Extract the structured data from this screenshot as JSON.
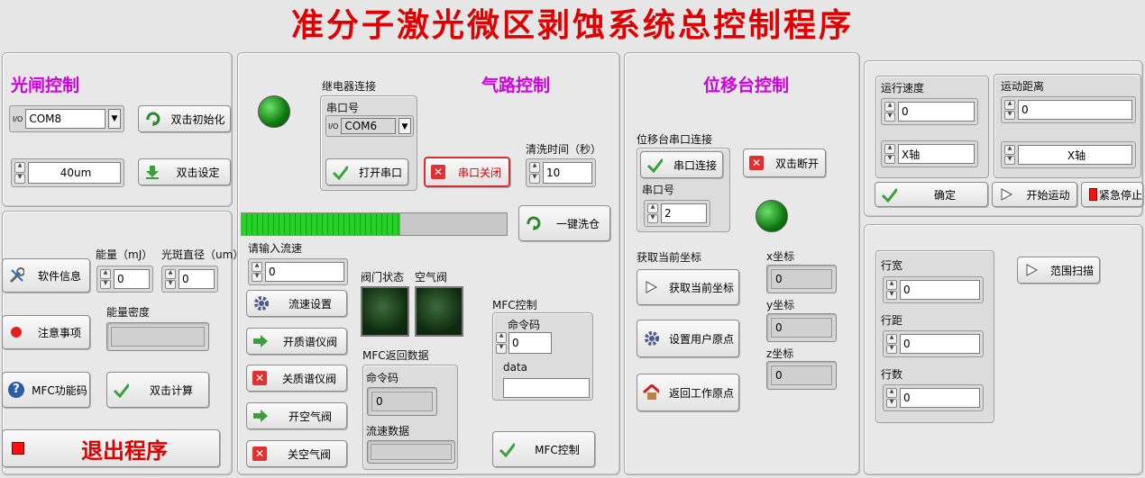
{
  "title": "准分子激光微区剥蚀系统总控制程序",
  "shutter": {
    "title": "光闸控制",
    "port_prefix": "I/O",
    "port_value": "COM8",
    "init_button": "双击初始化",
    "aperture_value": "40um",
    "set_button": "双击设定"
  },
  "left_lower": {
    "software_info": "软件信息",
    "notes": "注意事项",
    "mfc_codes": "MFC功能码",
    "energy_label": "能量（mJ）",
    "energy_value": "0",
    "spot_label": "光斑直径（um）",
    "spot_value": "0",
    "density_label": "能量密度",
    "density_value": "",
    "calc_button": "双击计算",
    "exit_button": "退出程序"
  },
  "gas": {
    "title": "气路控制",
    "relay_label": "继电器连接",
    "port_label": "串口号",
    "port_prefix": "I/O",
    "port_value": "COM6",
    "open_port": "打开串口",
    "close_port": "串口关闭",
    "purge_time_label": "清洗时间（秒）",
    "purge_time_value": "10",
    "one_key_wash": "一键洗仓",
    "progress": 0.6,
    "flow_input_label": "请输入流速",
    "flow_value": "0",
    "flow_set": "流速设置",
    "open_mass_valve": "开质谱仪阀",
    "close_mass_valve": "关质谱仪阀",
    "open_air_valve": "开空气阀",
    "close_air_valve": "关空气阀",
    "valve_state_label": "阀门状态",
    "air_valve_label": "空气阀",
    "mfc_return_label": "MFC返回数据",
    "cmd_code_label": "命令码",
    "cmd_code_value": "0",
    "flow_data_label": "流速数据",
    "flow_data_value": "",
    "mfc_ctrl_label": "MFC控制",
    "mfc_cmd_label": "命令码",
    "mfc_cmd_value": "0",
    "data_label": "data",
    "data_value": "",
    "mfc_ctrl_button": "MFC控制"
  },
  "stage": {
    "title": "位移台控制",
    "port_conn_label": "位移台串口连接",
    "port_connect": "串口连接",
    "port_label": "串口号",
    "port_value": "2",
    "disconnect": "双击断开",
    "get_coord_label": "获取当前坐标",
    "get_coord_button": "获取当前坐标",
    "set_origin": "设置用户原点",
    "return_home": "返回工作原点",
    "x_label": "x坐标",
    "x_value": "0",
    "y_label": "y坐标",
    "y_value": "0",
    "z_label": "z坐标",
    "z_value": "0"
  },
  "motion": {
    "speed_label": "运行速度",
    "speed_value": "0",
    "speed_axis": "X轴",
    "distance_label": "运动距离",
    "distance_value": "0",
    "distance_axis": "X轴",
    "confirm": "确定",
    "start": "开始运动",
    "estop": "紧急停止"
  },
  "scan": {
    "row_width_label": "行宽",
    "row_width_value": "0",
    "row_pitch_label": "行距",
    "row_pitch_value": "0",
    "row_count_label": "行数",
    "row_count_value": "0",
    "range_scan": "范围扫描"
  }
}
